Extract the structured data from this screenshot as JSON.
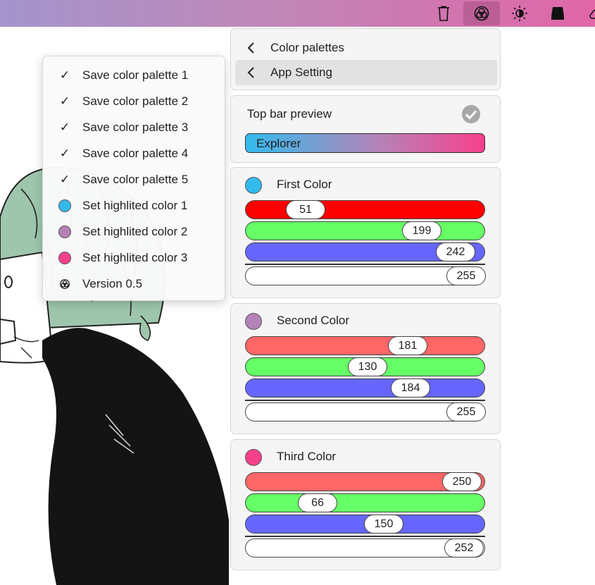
{
  "toolbar": {
    "icons": [
      "trash-icon",
      "palette-icon",
      "brightness-icon",
      "drive-icon",
      "weather-icon"
    ],
    "active": "palette-icon",
    "gradient": [
      "#a394cc",
      "#e066a8"
    ]
  },
  "menu": {
    "items": [
      {
        "icon": "check-icon",
        "label": "Save color palette 1"
      },
      {
        "icon": "check-icon",
        "label": "Save color palette 2"
      },
      {
        "icon": "check-icon",
        "label": "Save color palette 3"
      },
      {
        "icon": "check-icon",
        "label": "Save color palette 4"
      },
      {
        "icon": "check-icon",
        "label": "Save color palette 5"
      },
      {
        "icon": "dot",
        "color": "#33bbee",
        "label": "Set highlited color 1"
      },
      {
        "icon": "dot",
        "color": "#b582b8",
        "label": "Set highlited color 2"
      },
      {
        "icon": "dot",
        "color": "#f7408c",
        "label": "Set highlited color 3"
      },
      {
        "icon": "palette-icon",
        "label": "Version 0.5"
      }
    ]
  },
  "nav": {
    "items": [
      {
        "label": "Color palettes",
        "selected": false
      },
      {
        "label": "App Setting",
        "selected": true
      }
    ]
  },
  "preview": {
    "title": "Top bar preview",
    "bar_text": "Explorer"
  },
  "colors": [
    {
      "title": "First Color",
      "swatch": "#33bbee",
      "r": 51,
      "g": 199,
      "b": 242,
      "a": 255
    },
    {
      "title": "Second Color",
      "swatch": "#b582b8",
      "r": 181,
      "g": 130,
      "b": 184,
      "a": 255
    },
    {
      "title": "Third Color",
      "swatch": "#f7408c",
      "r": 250,
      "g": 66,
      "b": 150,
      "a": 252
    }
  ]
}
